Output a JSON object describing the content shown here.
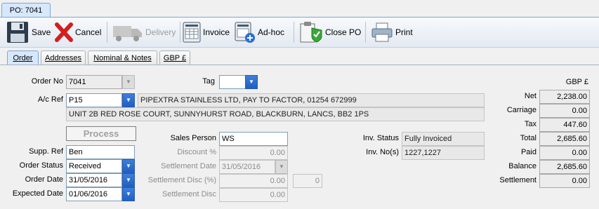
{
  "window": {
    "tab": "PO: 7041"
  },
  "toolbar": {
    "save": "Save",
    "cancel": "Cancel",
    "delivery": "Delivery",
    "invoice": "Invoice",
    "adhoc": "Ad-hoc",
    "close_po": "Close PO",
    "print": "Print"
  },
  "tabs": [
    "Order",
    "Addresses",
    "Nominal & Notes",
    "GBP £"
  ],
  "form": {
    "order_no_label": "Order No",
    "order_no": "7041",
    "tag_label": "Tag",
    "tag": "",
    "ac_ref_label": "A/c Ref",
    "ac_ref": "P15",
    "supplier_line1": "PIPEXTRA STAINLESS LTD, PAY TO FACTOR, 01254 672999",
    "supplier_line2": "UNIT 2B RED ROSE COURT, SUNNYHURST ROAD, BLACKBURN, LANCS, BB2 1PS",
    "process_label": "Process",
    "supp_ref_label": "Supp. Ref",
    "supp_ref": "Ben",
    "order_status_label": "Order Status",
    "order_status": "Received",
    "order_date_label": "Order Date",
    "order_date": "31/05/2016",
    "expected_date_label": "Expected Date",
    "expected_date": "01/06/2016",
    "sales_person_label": "Sales Person",
    "sales_person": "WS",
    "discount_label": "Discount %",
    "discount": "0.00",
    "settlement_date_label": "Settlement Date",
    "settlement_date": "31/05/2016",
    "settlement_disc_pct_label": "Settlement Disc (%)",
    "settlement_disc_pct": "0.00",
    "settlement_days": "0",
    "settlement_disc_label": "Settlement Disc",
    "settlement_disc": "0.00",
    "inv_status_label": "Inv. Status",
    "inv_status": "Fully Invoiced",
    "inv_nos_label": "Inv. No(s)",
    "inv_nos": "1227,1227"
  },
  "totals": {
    "currency": "GBP £",
    "rows": [
      {
        "label": "Net",
        "value": "2,238.00"
      },
      {
        "label": "Carriage",
        "value": "0.00"
      },
      {
        "label": "Tax",
        "value": "447.60"
      },
      {
        "label": "Total",
        "value": "2,685.60"
      },
      {
        "label": "Paid",
        "value": "0.00"
      },
      {
        "label": "Balance",
        "value": "2,685.60"
      },
      {
        "label": "Settlement",
        "value": "0.00"
      }
    ]
  },
  "colors": {
    "accent": "#2a6fd6",
    "tab_active": "#d6e8fb"
  },
  "icons": [
    "save-icon",
    "cancel-icon",
    "delivery-icon",
    "invoice-icon",
    "adhoc-icon",
    "close-po-icon",
    "print-icon"
  ]
}
